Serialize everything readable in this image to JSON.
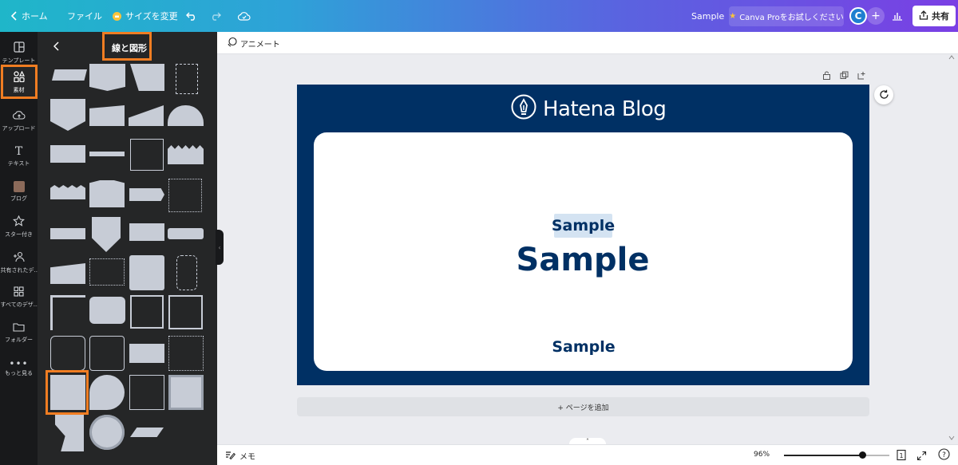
{
  "topbar": {
    "home_label": "ホーム",
    "file_label": "ファイル",
    "resize_label": "サイズを変更",
    "title": "Sample",
    "pro_label": "Canva Proをお試しください",
    "avatar_letter": "C",
    "share_label": "共有"
  },
  "rail": {
    "items": [
      {
        "label": "テンプレート",
        "icon": "layout-icon"
      },
      {
        "label": "素材",
        "icon": "elements-icon"
      },
      {
        "label": "アップロード",
        "icon": "cloud-upload-icon"
      },
      {
        "label": "テキスト",
        "icon": "text-icon"
      },
      {
        "label": "ブログ",
        "icon": "blog-thumbnail-icon"
      },
      {
        "label": "スター付き",
        "icon": "star-icon"
      },
      {
        "label": "共有されたデ...",
        "icon": "shared-icon"
      },
      {
        "label": "すべてのデザ...",
        "icon": "grid-icon"
      },
      {
        "label": "フォルダー",
        "icon": "folder-icon"
      },
      {
        "label": "もっと見る",
        "icon": "more-icon"
      }
    ],
    "active": "素材"
  },
  "panel": {
    "title": "線と図形"
  },
  "editor": {
    "animate_label": "アニメート",
    "brand_name": "Hatena Blog",
    "text_small": "Sample",
    "text_large": "Sample",
    "text_bottom": "Sample",
    "add_page_label": "+ ページを追加"
  },
  "bottombar": {
    "notes_label": "メモ",
    "zoom_label": "96%",
    "zoom_value": 0.74,
    "page_count": "1"
  },
  "colors": {
    "canvas_bg": "#003064",
    "highlight": "#f07d22",
    "panel_bg": "#252627",
    "shape_fill": "#c7ccd6"
  }
}
